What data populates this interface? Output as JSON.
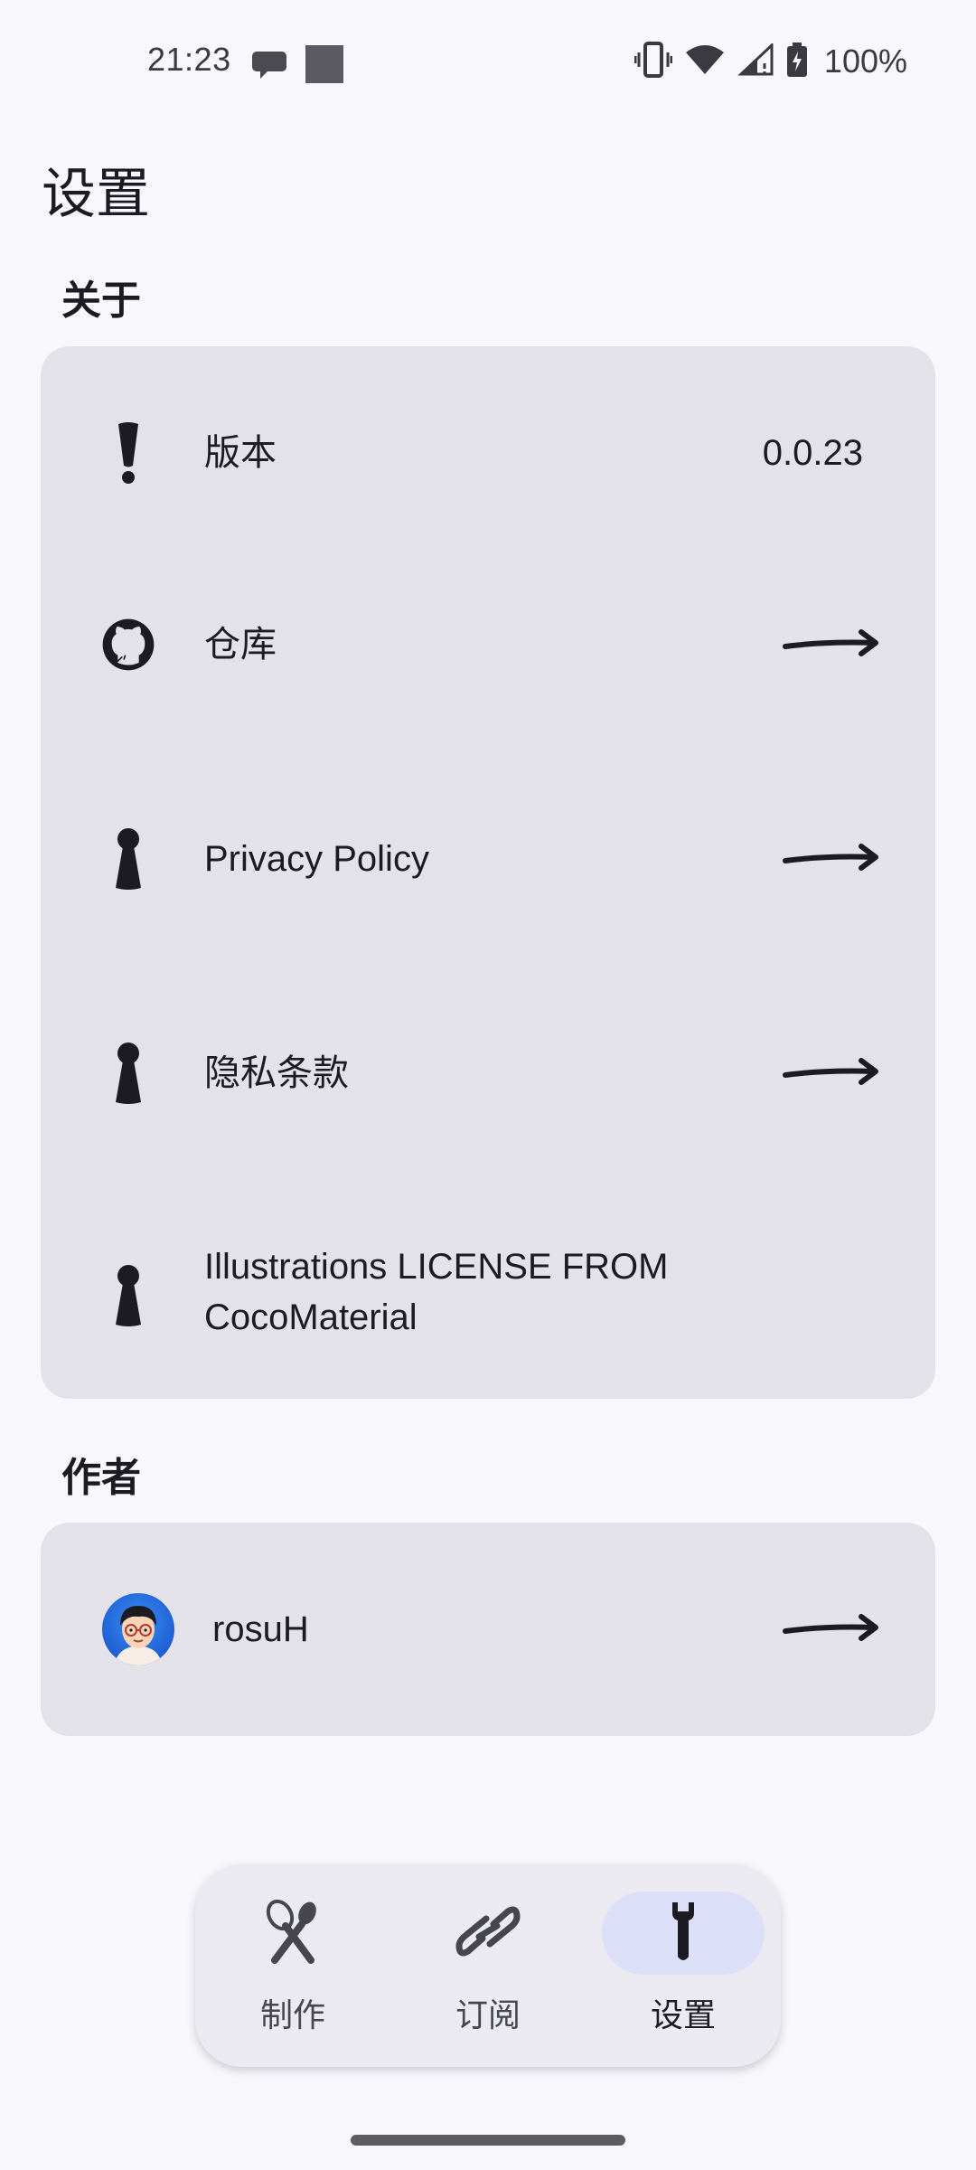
{
  "status_bar": {
    "time": "21:23",
    "battery": "100%",
    "icons": [
      "chat-icon",
      "square-icon",
      "vibrate-icon",
      "wifi-icon",
      "signal-icon",
      "battery-icon"
    ]
  },
  "page": {
    "title": "设置"
  },
  "about": {
    "title": "关于",
    "items": [
      {
        "icon": "exclamation-icon",
        "label": "版本",
        "value": "0.0.23"
      },
      {
        "icon": "github-icon",
        "label": "仓库"
      },
      {
        "icon": "keyhole-icon",
        "label": "Privacy Policy"
      },
      {
        "icon": "keyhole-icon",
        "label": "隐私条款"
      },
      {
        "icon": "keyhole-icon",
        "label": "Illustrations LICENSE FROM CocoMaterial"
      }
    ]
  },
  "author": {
    "title": "作者",
    "name": "rosuH"
  },
  "nav": {
    "items": [
      {
        "label": "制作",
        "icon": "whisk-icon"
      },
      {
        "label": "订阅",
        "icon": "link-icon"
      },
      {
        "label": "设置",
        "icon": "wrench-icon",
        "active": true
      }
    ]
  },
  "colors": {
    "background": "#f8f7fc",
    "card": "#e3e2e8",
    "nav_bar": "#ebeaf0",
    "active_pill": "#dbe0f8",
    "text": "#1b1b21"
  }
}
